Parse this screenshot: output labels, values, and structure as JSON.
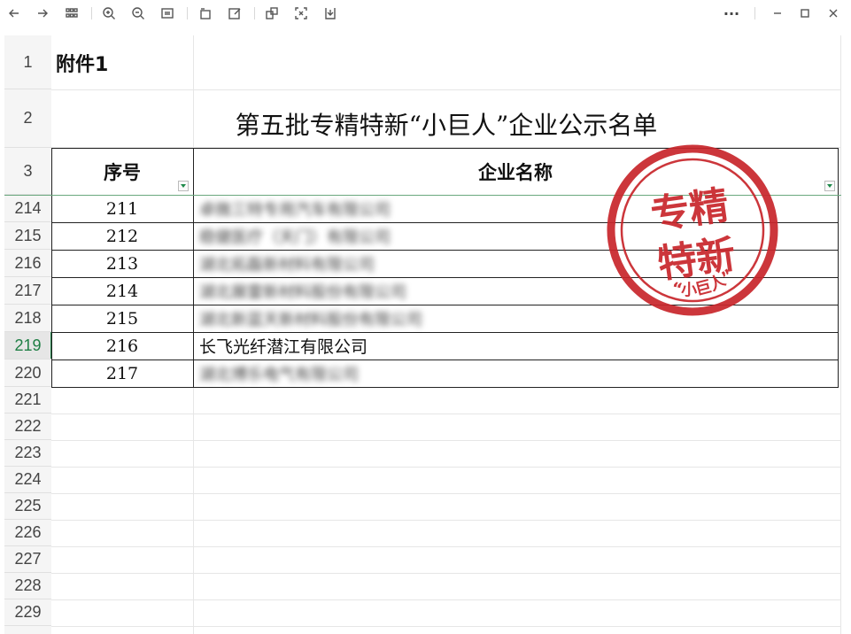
{
  "toolbar": {
    "items": [
      "back-icon",
      "forward-icon",
      "grid-icon",
      "zoom-in-icon",
      "zoom-out-icon",
      "fit-icon",
      "rotate-icon",
      "edit-icon",
      "copy-icon",
      "crop-icon",
      "download-icon"
    ],
    "more": "···"
  },
  "sheet": {
    "title_cell": "附件1",
    "heading": "第五批专精特新“小巨人”企业公示名单",
    "header": {
      "index": "序号",
      "name": "企业名称"
    },
    "header_rows": [
      "1",
      "2",
      "3"
    ],
    "rows": [
      {
        "row_number": "214",
        "index": "211",
        "name": "卓微三特专用汽车有限公司",
        "blurred": true
      },
      {
        "row_number": "215",
        "index": "212",
        "name": "稳健医疗（天门）有限公司",
        "blurred": true
      },
      {
        "row_number": "216",
        "index": "213",
        "name": "湖北拓磊新材料有限公司",
        "blurred": true
      },
      {
        "row_number": "217",
        "index": "214",
        "name": "湖北展雷新材料股份有限公司",
        "blurred": true
      },
      {
        "row_number": "218",
        "index": "215",
        "name": "湖北新蓝天新材料股份有限公司",
        "blurred": true
      },
      {
        "row_number": "219",
        "index": "216",
        "name": "长飞光纤潜江有限公司",
        "blurred": false,
        "active": true
      },
      {
        "row_number": "220",
        "index": "217",
        "name": "湖北博乐电气有限公司",
        "blurred": true
      }
    ],
    "empty_rows": [
      "221",
      "222",
      "223",
      "224",
      "225",
      "226",
      "227",
      "228",
      "229"
    ]
  },
  "stamp": {
    "line1": "专精",
    "line2": "特新",
    "arc": "“小巨人”",
    "color": "#c8262b"
  }
}
